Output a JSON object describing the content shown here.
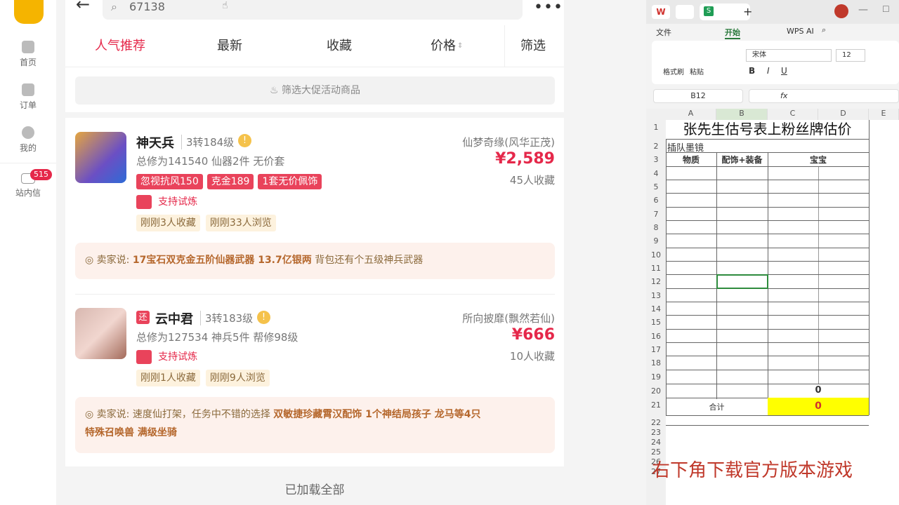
{
  "rail": {
    "items": [
      {
        "label": "首页"
      },
      {
        "label": "订单"
      },
      {
        "label": "我的"
      },
      {
        "label": "站内信",
        "badge": "515"
      }
    ]
  },
  "search": {
    "value": "67138"
  },
  "tabs": [
    "人气推荐",
    "最新",
    "收藏",
    "价格",
    "筛选"
  ],
  "promo_filter": "筛选大促活动商品",
  "listings": [
    {
      "name": "神天兵",
      "level": "3转184级",
      "stats": "总修为141540  仙器2件  无价套",
      "tags": [
        "忽视抗风150",
        "克金189",
        "1套无价佩饰"
      ],
      "trial": "支持试炼",
      "activity": [
        "刚刚3人收藏",
        "刚刚33人浏览"
      ],
      "server": "仙梦奇缘(风华正茂)",
      "price": "¥2,589",
      "favorites": "45人收藏",
      "seller_prefix": "卖家说:",
      "seller_bold": "17宝石双克金五阶仙器武器 13.7亿银两",
      "seller_rest": "背包还有个五级神兵武器"
    },
    {
      "badge": "还",
      "name": "云中君",
      "level": "3转183级",
      "stats": "总修为127534  神兵5件  帮修98级",
      "trial": "支持试炼",
      "activity": [
        "刚刚1人收藏",
        "刚刚9人浏览"
      ],
      "server": "所向披靡(飘然若仙)",
      "price": "¥666",
      "favorites": "10人收藏",
      "seller_prefix": "卖家说:",
      "seller_plain": "速度仙打架，任务中不错的选择",
      "seller_bold1": "双敏捷珍藏霄汉配饰 1个神结局孩子 龙马等4只",
      "seller_bold2": "特殊召唤兽 满级坐骑"
    }
  ],
  "footer": "已加载全部",
  "excel": {
    "tabs": [
      "W",
      "S"
    ],
    "menu": [
      "文件",
      "开始",
      "WPS AI"
    ],
    "ribbon": {
      "format_painter": "格式刷",
      "paste": "粘贴"
    },
    "font": "宋体",
    "font_size": "12",
    "cell_ref": "B12",
    "fx": "fx",
    "columns": [
      "A",
      "B",
      "C",
      "D",
      "E"
    ],
    "title": "张先生估号表上粉丝牌估价",
    "row2": "插队墨镜",
    "headers": [
      "物质",
      "配饰+装备",
      "宝宝"
    ],
    "row20_value": "0",
    "total_label": "合计",
    "total_value": "0",
    "overlay": "右下角下载官方版本游戏"
  }
}
